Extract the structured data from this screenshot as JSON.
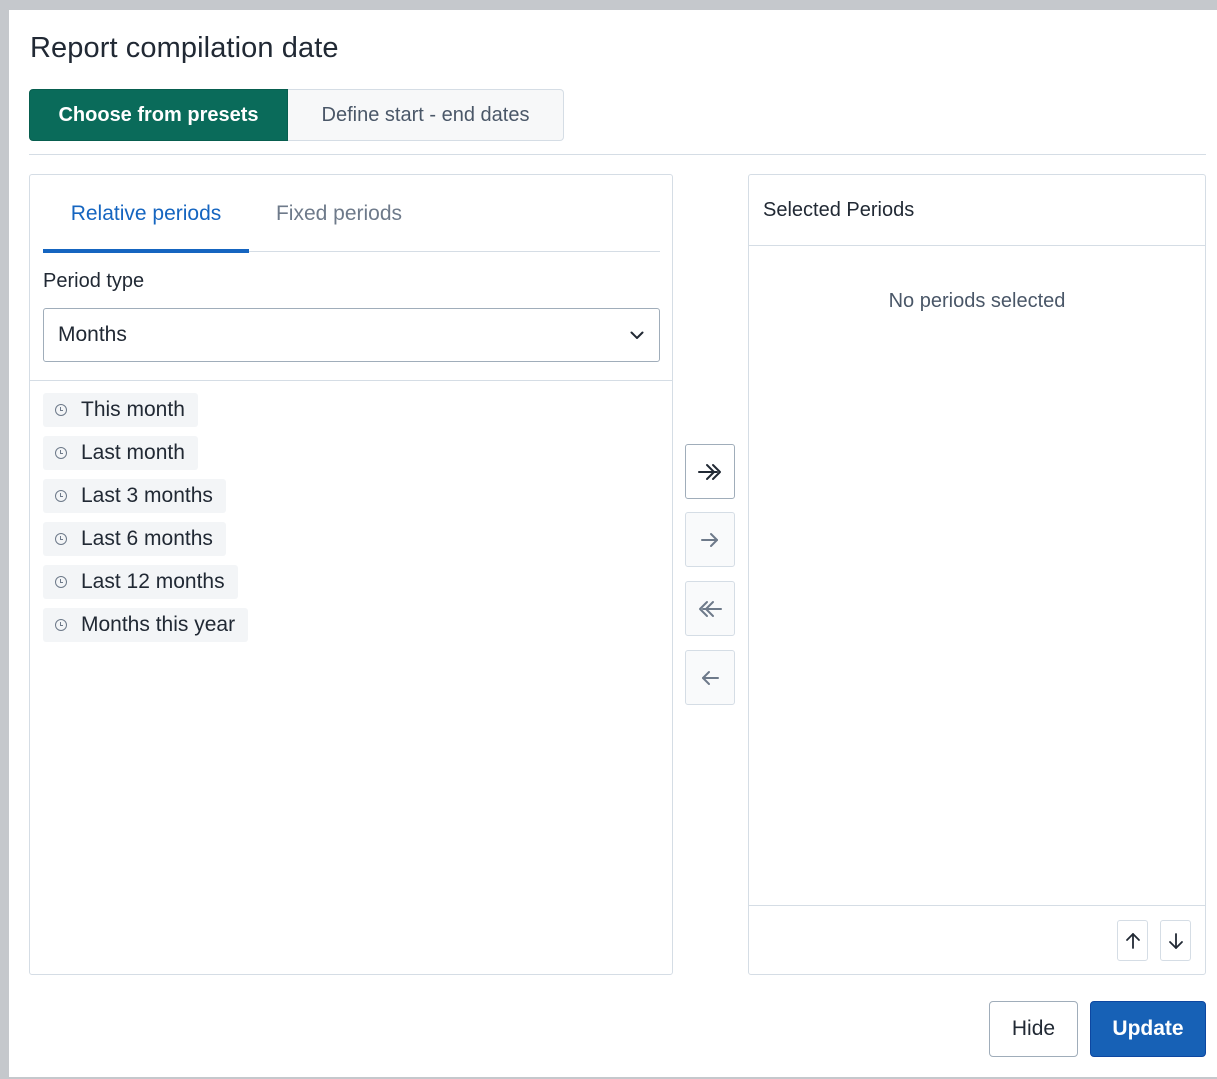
{
  "dialog": {
    "title": "Report compilation date"
  },
  "mode_toggle": {
    "presets_label": "Choose from presets",
    "dates_label": "Define start - end dates"
  },
  "period_tabs": {
    "relative_label": "Relative periods",
    "fixed_label": "Fixed periods"
  },
  "period_type": {
    "label": "Period type",
    "selected": "Months",
    "icon": "chevron-down-icon"
  },
  "available_periods": [
    {
      "label": "This month",
      "icon": "clock-icon"
    },
    {
      "label": "Last month",
      "icon": "clock-icon"
    },
    {
      "label": "Last 3 months",
      "icon": "clock-icon"
    },
    {
      "label": "Last 6 months",
      "icon": "clock-icon"
    },
    {
      "label": "Last 12 months",
      "icon": "clock-icon"
    },
    {
      "label": "Months this year",
      "icon": "clock-icon"
    }
  ],
  "transfer_buttons": [
    {
      "name": "select-all",
      "icon": "double-arrow-right-icon"
    },
    {
      "name": "select-one",
      "icon": "arrow-right-icon"
    },
    {
      "name": "deselect-all",
      "icon": "double-arrow-left-icon"
    },
    {
      "name": "deselect-one",
      "icon": "arrow-left-icon"
    }
  ],
  "selected_periods": {
    "header": "Selected Periods",
    "empty_text": "No periods selected",
    "move_up_icon": "arrow-up-icon",
    "move_down_icon": "arrow-down-icon"
  },
  "actions": {
    "hide_label": "Hide",
    "update_label": "Update"
  },
  "colors": {
    "primary_green": "#0a6b5a",
    "accent_blue": "#1565c0",
    "update_blue": "#1761b6"
  }
}
